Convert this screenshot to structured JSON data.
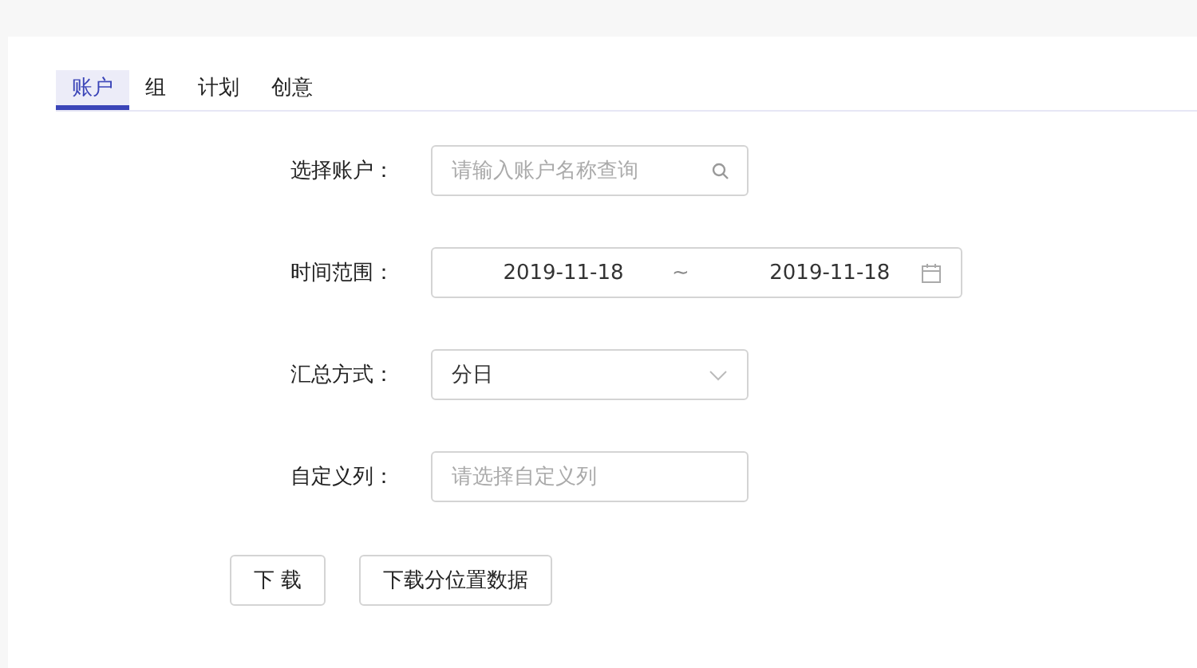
{
  "tabs": [
    {
      "label": "账户",
      "selected": true
    },
    {
      "label": "组",
      "selected": false
    },
    {
      "label": "计划",
      "selected": false
    },
    {
      "label": "创意",
      "selected": false
    }
  ],
  "form": [
    {
      "label": "选择账户：",
      "kind": "search",
      "placeholder": "请输入账户名称查询"
    },
    {
      "label": "时间范围：",
      "kind": "daterange",
      "start": "2019-11-18",
      "separator": "~",
      "end": "2019-11-18"
    },
    {
      "label": "汇总方式：",
      "kind": "select",
      "value": "分日"
    },
    {
      "label": "自定义列：",
      "kind": "text",
      "placeholder": "请选择自定义列"
    }
  ],
  "buttons": [
    "下 载",
    "下载分位置数据"
  ]
}
